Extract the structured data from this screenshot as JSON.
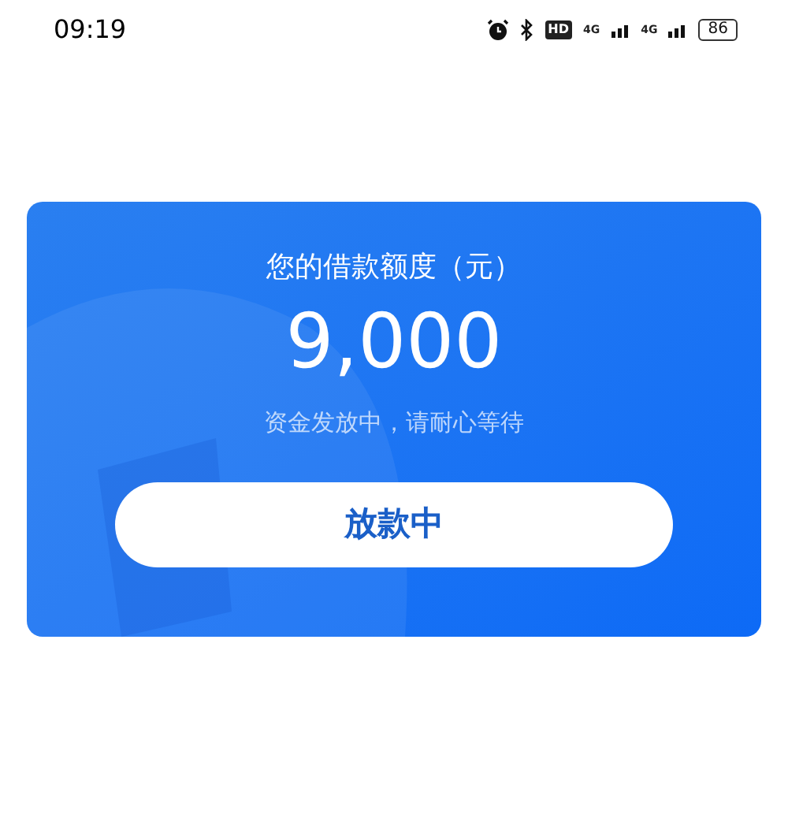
{
  "status_bar": {
    "time": "09:19",
    "hd_badge": "HD",
    "network_1": "4G",
    "network_2": "4G",
    "battery": "86"
  },
  "loan_card": {
    "title": "您的借款额度（元）",
    "amount": "9,000",
    "subtitle": "资金发放中，请耐心等待",
    "button": "放款中"
  }
}
